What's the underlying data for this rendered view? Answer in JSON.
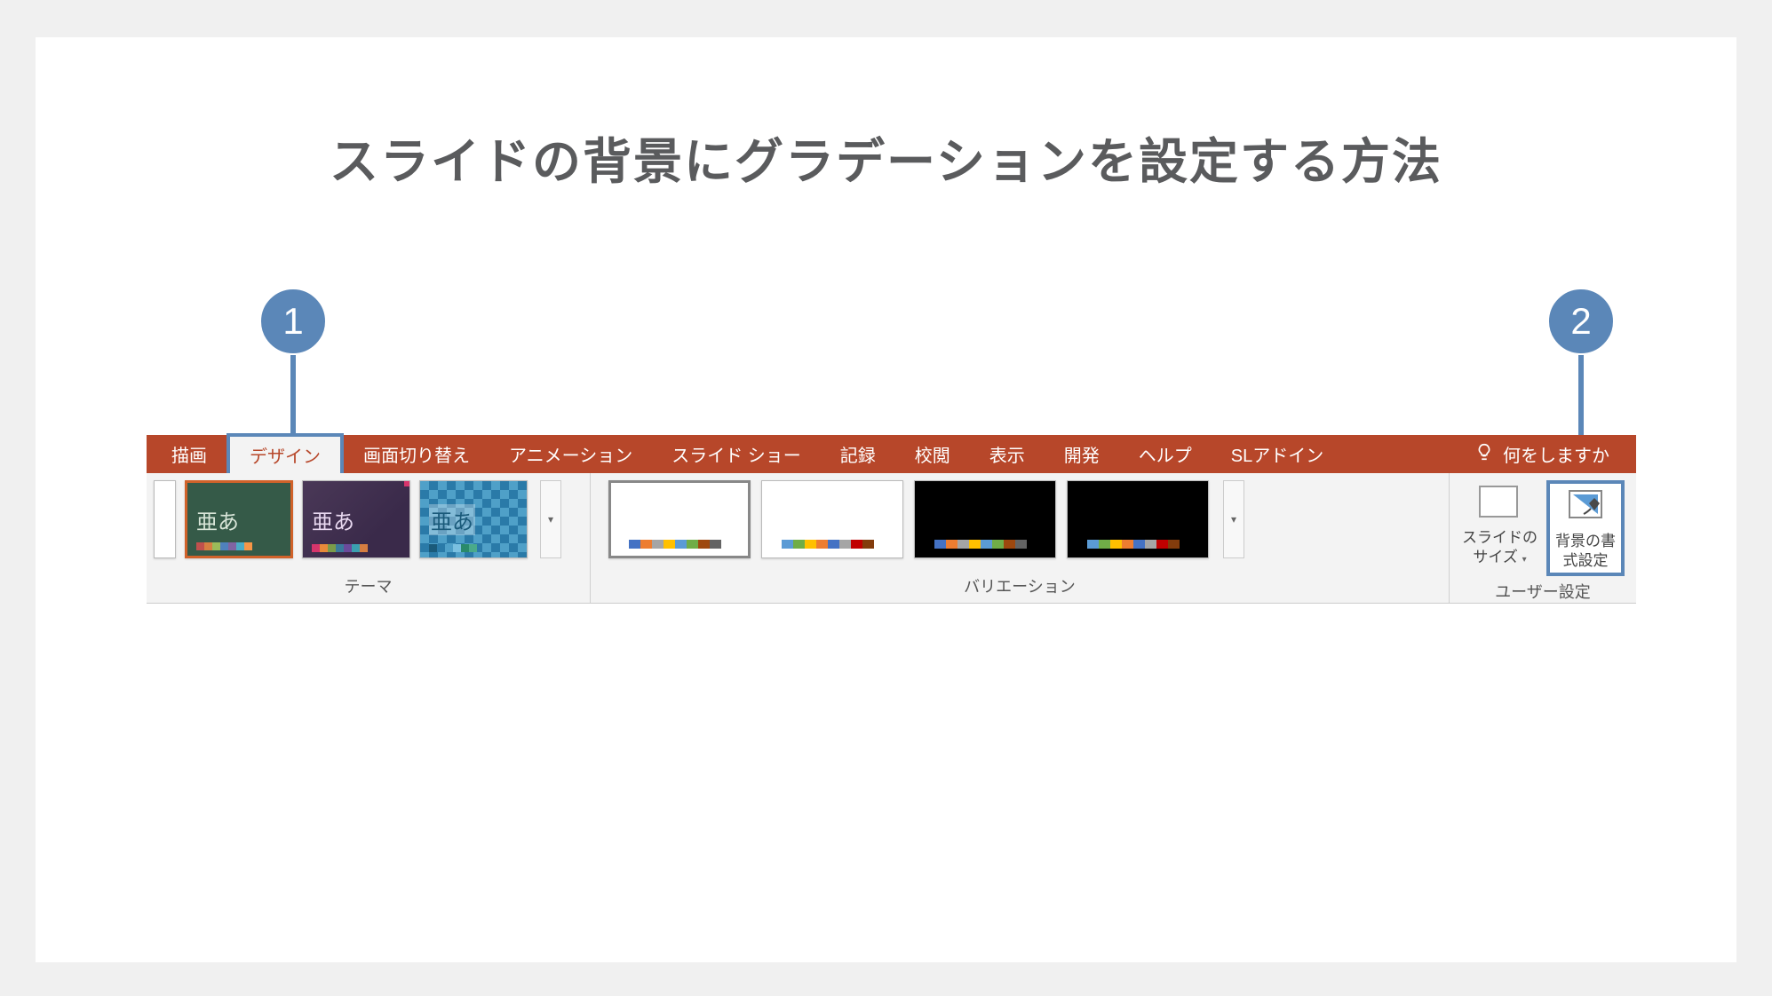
{
  "page_title": "スライドの背景にグラデーションを設定する方法",
  "callouts": {
    "one": "1",
    "two": "2"
  },
  "ribbon": {
    "tabs": {
      "draw": "描画",
      "design": "デザイン",
      "transitions": "画面切り替え",
      "animations": "アニメーション",
      "slideshow": "スライド ショー",
      "record": "記録",
      "review": "校閲",
      "view": "表示",
      "developer": "開発",
      "help": "ヘルプ",
      "sladdin": "SLアドイン"
    },
    "tell_me": "何をしますか",
    "theme_sample": "亜あ",
    "sections": {
      "themes": "テーマ",
      "variations": "バリエーション",
      "customize": "ユーザー設定"
    },
    "slide_size": "スライドの\nサイズ",
    "format_background": "背景の書\n式設定"
  }
}
